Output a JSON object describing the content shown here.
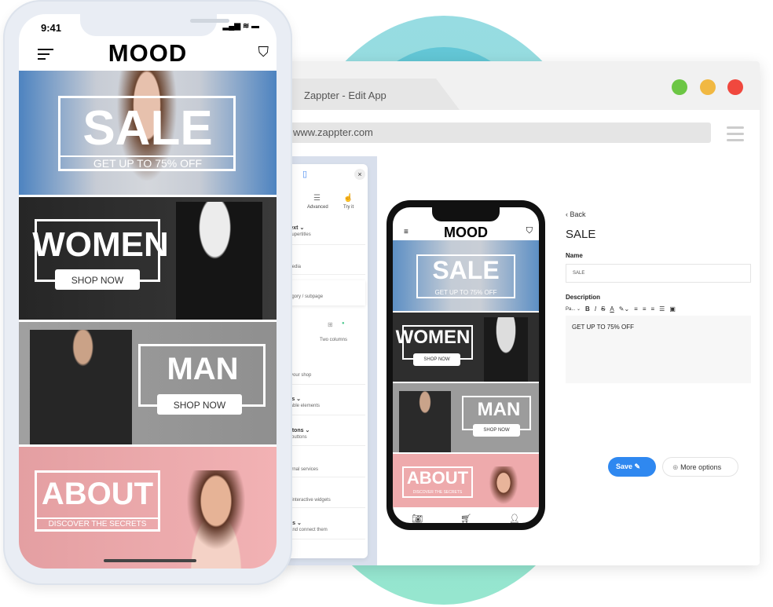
{
  "browser": {
    "tab_title": "Zappter - Edit App",
    "url": "www.zappter.com",
    "window_controls": [
      "green",
      "yellow",
      "red"
    ],
    "colors": {
      "green": "#6cc644",
      "yellow": "#f1b842",
      "red": "#f0483e"
    }
  },
  "side_panel": {
    "tabs": [
      "Advanced",
      "Try it"
    ],
    "items": [
      {
        "title": "...d text",
        "subtitle": "...nd supertitles"
      },
      {
        "title": "",
        "subtitle": "...of media"
      },
      {
        "title": "",
        "subtitle": "...category / subpage"
      },
      {
        "title": "",
        "subtitle": "Two columns"
      },
      {
        "title": "...e",
        "subtitle": "...out your shop"
      },
      {
        "title": "...ings",
        "subtitle": "...ookable elements"
      },
      {
        "title": "...buttons",
        "subtitle": "...tive buttons"
      },
      {
        "title": "",
        "subtitle": "...external services"
      },
      {
        "title": "",
        "subtitle": "...any interactive widgets"
      },
      {
        "title": "...ffers",
        "subtitle": "...ws and connect them"
      }
    ]
  },
  "editor": {
    "back_label": "Back",
    "heading": "SALE",
    "name_label": "Name",
    "name_value": "SALE",
    "description_label": "Description",
    "toolbar": [
      "Pa...",
      "B",
      "I",
      "S",
      "A",
      "highlight",
      "align-left",
      "align-center",
      "align-right",
      "justify",
      "clear"
    ],
    "description_value": "GET UP TO 75% OFF",
    "save_label": "Save",
    "more_label": "More options",
    "save_color": "#2f88f0"
  },
  "app": {
    "brand": "MOOD",
    "time": "9:41",
    "banners": [
      {
        "title": "SALE",
        "subtitle": "GET UP TO 75% OFF"
      },
      {
        "title": "WOMEN",
        "button": "SHOP NOW"
      },
      {
        "title": "MAN",
        "button": "SHOP NOW"
      },
      {
        "title": "ABOUT",
        "subtitle": "DISCOVER THE SECRETS"
      }
    ],
    "tabbar": [
      "camera",
      "cart",
      "profile"
    ]
  }
}
